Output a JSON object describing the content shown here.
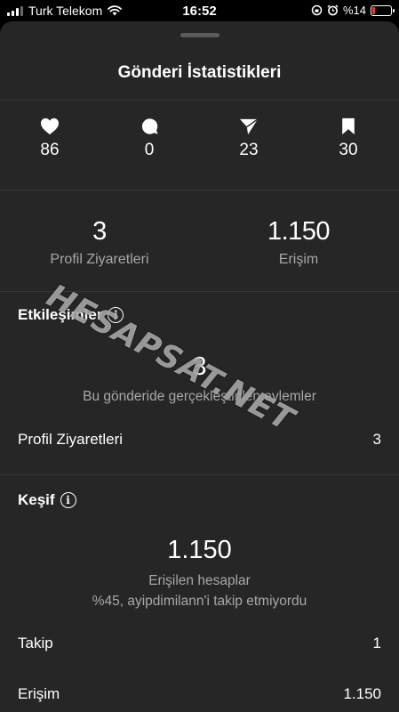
{
  "status_bar": {
    "carrier": "Turk Telekom",
    "time": "16:52",
    "battery_percent_text": "%14",
    "battery_level": 0.14,
    "battery_color": "#e53935"
  },
  "sheet": {
    "title": "Gönderi İstatistikleri"
  },
  "metrics": [
    {
      "icon": "heart-icon",
      "value": "86"
    },
    {
      "icon": "comment-icon",
      "value": "0"
    },
    {
      "icon": "send-icon",
      "value": "23"
    },
    {
      "icon": "bookmark-icon",
      "value": "30"
    }
  ],
  "summary": {
    "profile_visits": {
      "value": "3",
      "label": "Profil Ziyaretleri"
    },
    "reach": {
      "value": "1.150",
      "label": "Erişim"
    }
  },
  "interactions": {
    "title": "Etkileşimler",
    "value": "3",
    "subtitle": "Bu gönderide gerçekleştirilen eylemler",
    "rows": [
      {
        "label": "Profil Ziyaretleri",
        "value": "3"
      }
    ]
  },
  "discovery": {
    "title": "Keşif",
    "value": "1.150",
    "subtitle": "Erişilen hesaplar",
    "note": "%45, ayipdimilann'i takip etmiyordu",
    "rows": [
      {
        "label": "Takip",
        "value": "1"
      },
      {
        "label": "Erişim",
        "value": "1.150"
      }
    ]
  },
  "watermark": "HESAPSAT.NET"
}
